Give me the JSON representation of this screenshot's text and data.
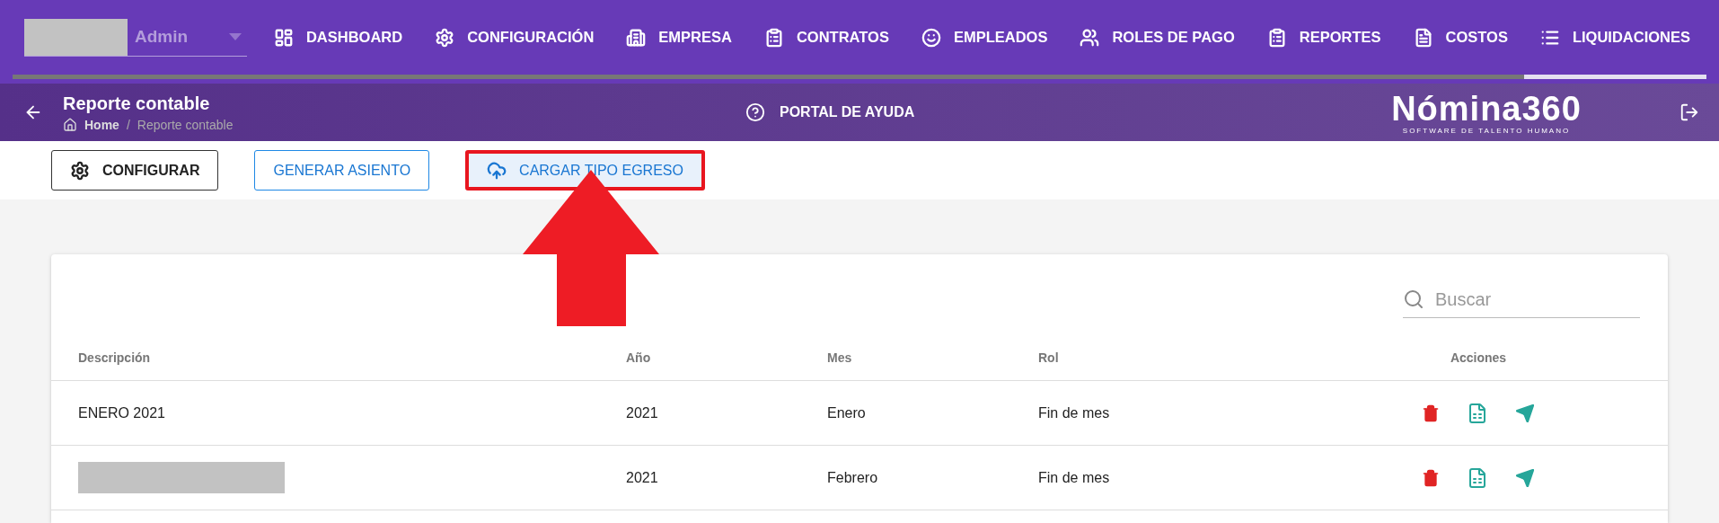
{
  "user": {
    "role": "Admin"
  },
  "nav": [
    {
      "label": "DASHBOARD",
      "selected": false
    },
    {
      "label": "CONFIGURACIÓN",
      "selected": false
    },
    {
      "label": "EMPRESA",
      "selected": false
    },
    {
      "label": "CONTRATOS",
      "selected": false
    },
    {
      "label": "EMPLEADOS",
      "selected": false
    },
    {
      "label": "ROLES DE PAGO",
      "selected": false
    },
    {
      "label": "REPORTES",
      "selected": false
    },
    {
      "label": "COSTOS",
      "selected": false
    },
    {
      "label": "LIQUIDACIONES",
      "selected": true
    }
  ],
  "header": {
    "title": "Reporte contable",
    "breadcrumb": [
      "Home",
      "Reporte contable"
    ],
    "separator": "/",
    "help": "PORTAL DE AYUDA",
    "logo": "Nómina360",
    "tagline": "SOFTWARE DE TALENTO HUMANO"
  },
  "toolbar": [
    {
      "label": "CONFIGURAR",
      "kind": "dark",
      "highlighted": false
    },
    {
      "label": "GENERAR ASIENTO",
      "kind": "outline",
      "highlighted": false
    },
    {
      "label": "CARGAR TIPO EGRESO",
      "kind": "text",
      "highlighted": true
    }
  ],
  "search": {
    "placeholder": "Buscar"
  },
  "table": {
    "columns": [
      "Descripción",
      "Año",
      "Mes",
      "Rol",
      "Acciones"
    ],
    "rows": [
      {
        "description": "ENERO 2021",
        "redacted": false,
        "year": "2021",
        "month": "Enero",
        "role": "Fin de mes"
      },
      {
        "description": "",
        "redacted": true,
        "year": "2021",
        "month": "Febrero",
        "role": "Fin de mes"
      }
    ]
  }
}
